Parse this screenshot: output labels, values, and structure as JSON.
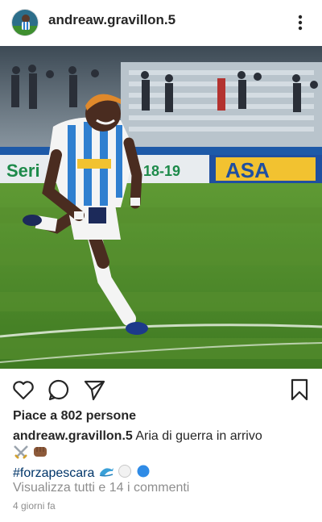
{
  "header": {
    "username": "andreaw.gravillon.5",
    "avatar_icon": "profile-photo",
    "more_icon": "more-vertical-icon"
  },
  "post": {
    "image_icon": "football-player-photo",
    "stadium_banners": [
      "Seri",
      "18-19",
      "ASA"
    ],
    "actions": {
      "like_icon": "heart-icon",
      "comment_icon": "comment-bubble-icon",
      "share_icon": "send-paper-plane-icon",
      "save_icon": "bookmark-icon"
    },
    "likes_text": "Piace a 802 persone",
    "caption": {
      "username": "andreaw.gravillon.5",
      "text": "Aria di guerra in arrivo",
      "emojis_line1": [
        "crossed-swords-emoji",
        "fist-emoji"
      ],
      "hashtag": "#forzapescara",
      "emojis_line2": [
        "dolphin-emoji",
        "white-circle-emoji",
        "blue-circle-emoji"
      ]
    },
    "view_comments_text": "Visualizza tutti e 14 i commenti",
    "timestamp": "4 giorni fa"
  },
  "colors": {
    "text": "#262626",
    "muted": "#8e8e8e",
    "hashtag": "#003569",
    "pitch_green": "#4f8a2c",
    "banner_gold": "#f2c230"
  }
}
